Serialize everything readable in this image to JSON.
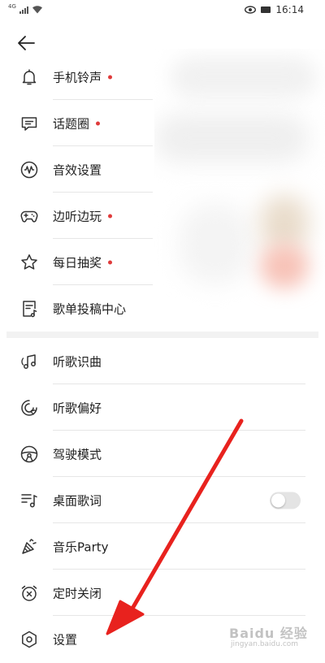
{
  "status_bar": {
    "signal_label": "4G",
    "time": "16:14"
  },
  "menu_top": [
    {
      "label": "手机铃声",
      "icon": "bell-icon",
      "badge": true
    },
    {
      "label": "话题圈",
      "icon": "chat-icon",
      "badge": true
    },
    {
      "label": "音效设置",
      "icon": "sound-wave-icon",
      "badge": false
    },
    {
      "label": "边听边玩",
      "icon": "gamepad-icon",
      "badge": true
    },
    {
      "label": "每日抽奖",
      "icon": "star-icon",
      "badge": true
    },
    {
      "label": "歌单投稿中心",
      "icon": "playlist-submit-icon",
      "badge": false
    }
  ],
  "menu_bottom": [
    {
      "label": "听歌识曲",
      "icon": "music-recognize-icon"
    },
    {
      "label": "听歌偏好",
      "icon": "preference-icon"
    },
    {
      "label": "驾驶模式",
      "icon": "steering-wheel-icon"
    },
    {
      "label": "桌面歌词",
      "icon": "desktop-lyrics-icon",
      "toggle_on": false
    },
    {
      "label": "音乐Party",
      "icon": "party-horn-icon"
    },
    {
      "label": "定时关闭",
      "icon": "alarm-off-icon"
    },
    {
      "label": "设置",
      "icon": "gear-icon"
    }
  ],
  "colors": {
    "badge": "#e03b3b",
    "arrow": "#e8221e",
    "divider": "#e6e6e6"
  },
  "watermark": {
    "brand": "Baidu 经验",
    "url": "jingyan.baidu.com"
  }
}
